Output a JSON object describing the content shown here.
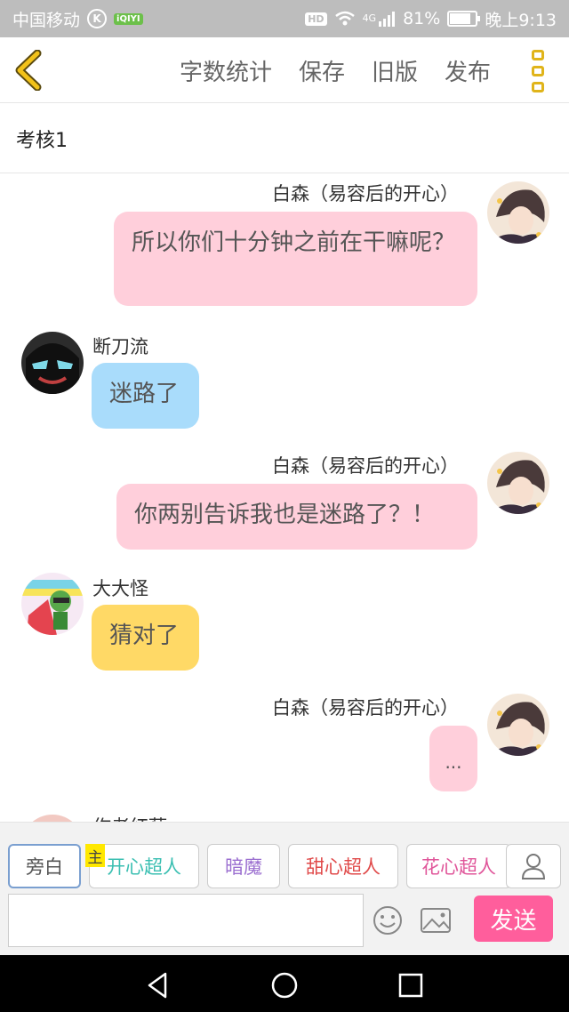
{
  "status_bar": {
    "carrier": "中国移动",
    "k_badge": "K",
    "iqiyi": "iQIYI",
    "hd": "HD",
    "network": "4G",
    "battery": "81%",
    "battery_level": 0.81,
    "time": "晚上9:13"
  },
  "toolbar": {
    "word_count": "字数统计",
    "save": "保存",
    "old_version": "旧版",
    "publish": "发布"
  },
  "title": "考核1",
  "messages": [
    {
      "side": "right",
      "name": "白森（易容后的开心）",
      "text": "所以你们十分钟之前在干嘛呢？",
      "color": "#ffcfdb"
    },
    {
      "side": "left",
      "name": "断刀流",
      "text": "迷路了",
      "color": "#a9dcfb"
    },
    {
      "side": "right",
      "name": "白森（易容后的开心）",
      "text": "你两别告诉我也是迷路了？！",
      "color": "#ffcfdb"
    },
    {
      "side": "left",
      "name": "大大怪",
      "text": "猜对了",
      "color": "#ffd966"
    },
    {
      "side": "right",
      "name": "白森（易容后的开心）",
      "text": "...",
      "color": "#ffcfdb"
    },
    {
      "side": "left",
      "name": "作者红藕",
      "text": "",
      "color": "#ffffff"
    }
  ],
  "roles": [
    {
      "label": "旁白",
      "color": "#555555"
    },
    {
      "label": "开心超人",
      "color": "#3bbfb2"
    },
    {
      "label": "暗魔",
      "color": "#9b6fd0"
    },
    {
      "label": "甜心超人",
      "color": "#e04a4a"
    },
    {
      "label": "花心超人",
      "color": "#e0569a"
    }
  ],
  "owner_tag": "主",
  "input": {
    "value": "",
    "placeholder": ""
  },
  "send_label": "发送",
  "colors": {
    "accent": "#e0b41a",
    "send": "#ff5e9c"
  }
}
